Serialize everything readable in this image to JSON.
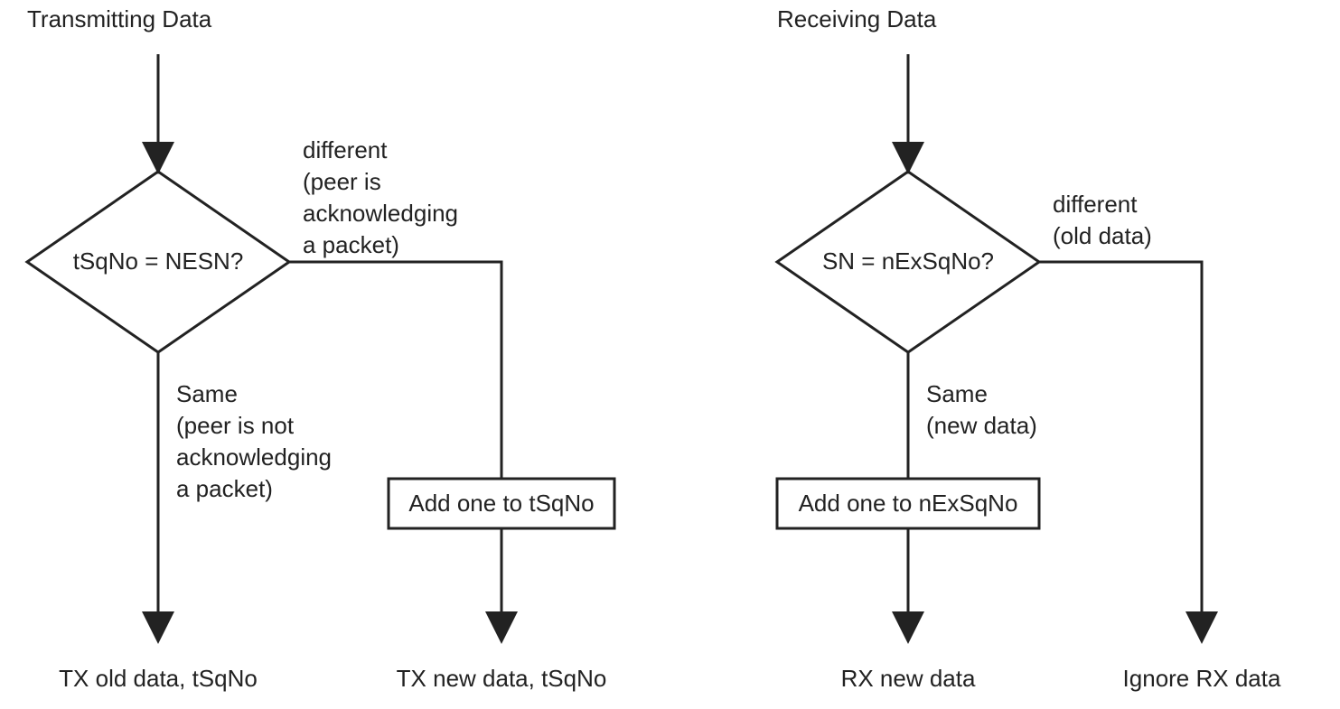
{
  "left": {
    "title": "Transmitting Data",
    "decision": "tSqNo = NESN?",
    "branch_right_l1": "different",
    "branch_right_l2": "(peer is",
    "branch_right_l3": " acknowledging",
    "branch_right_l4": "a packet)",
    "branch_down_l1": "Same",
    "branch_down_l2": "(peer is not",
    "branch_down_l3": "acknowledging",
    "branch_down_l4": "a packet)",
    "process": "Add one to tSqNo",
    "term_left": "TX old data, tSqNo",
    "term_right": "TX new data, tSqNo"
  },
  "right": {
    "title": "Receiving Data",
    "decision": "SN = nExSqNo?",
    "branch_right_l1": "different",
    "branch_right_l2": "(old data)",
    "branch_down_l1": "Same",
    "branch_down_l2": "(new data)",
    "process": "Add one to nExSqNo",
    "term_left": "RX new data",
    "term_right": "Ignore RX data"
  }
}
